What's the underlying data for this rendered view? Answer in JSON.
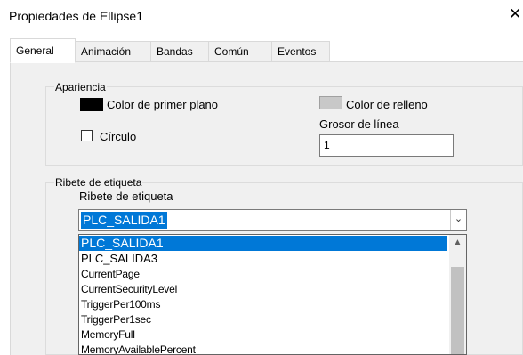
{
  "window": {
    "title": "Propiedades de Ellipse1",
    "close_glyph": "✕"
  },
  "tabs": [
    {
      "label": "General",
      "active": true
    },
    {
      "label": "Animación"
    },
    {
      "label": "Bandas"
    },
    {
      "label": "Común"
    },
    {
      "label": "Eventos"
    }
  ],
  "appearance": {
    "legend": "Apariencia",
    "foreground_label": "Color de primer plano",
    "foreground_color": "#000000",
    "fill_label": "Color de relleno",
    "fill_color": "#c8c8c8",
    "circle_label": "Círculo",
    "circle_checked": false,
    "line_width_label": "Grosor de línea",
    "line_width_value": "1"
  },
  "tag": {
    "legend": "Ribete de etiqueta",
    "label": "Ribete de etiqueta",
    "selected": "PLC_SALIDA1",
    "dropdown_icon": "chevron-down-icon",
    "options": [
      "PLC_SALIDA1",
      "PLC_SALIDA3",
      "CurrentPage",
      "CurrentSecurityLevel",
      "TriggerPer100ms",
      "TriggerPer1sec",
      "MemoryFull",
      "MemoryAvailablePercent"
    ]
  },
  "colors": {
    "accent": "#0078d7",
    "panel": "#f0f0f0"
  }
}
